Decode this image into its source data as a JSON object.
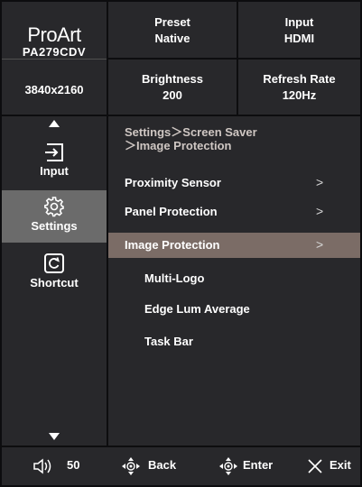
{
  "brand": {
    "name": "ProArt",
    "model": "PA279CDV",
    "resolution": "3840x2160"
  },
  "info": {
    "preset": {
      "label": "Preset",
      "value": "Native"
    },
    "input": {
      "label": "Input",
      "value": "HDMI"
    },
    "brightness": {
      "label": "Brightness",
      "value": "200"
    },
    "refresh_rate": {
      "label": "Refresh Rate",
      "value": "120Hz"
    }
  },
  "nav": {
    "items": [
      {
        "label": "Input",
        "icon": "input-icon",
        "selected": false
      },
      {
        "label": "Settings",
        "icon": "gear-icon",
        "selected": true
      },
      {
        "label": "Shortcut",
        "icon": "shortcut-icon",
        "selected": false
      }
    ]
  },
  "breadcrumb": {
    "line1": "Settings＞Screen Saver",
    "line2": "＞Image Protection"
  },
  "menu": {
    "items": [
      {
        "label": "Proximity Sensor",
        "chevron": ">"
      },
      {
        "label": "Panel Protection",
        "chevron": ">"
      },
      {
        "label": "Image Protection",
        "chevron": ">",
        "selected": true
      }
    ],
    "subitems": [
      {
        "label": "Multi-Logo"
      },
      {
        "label": "Edge Lum Average"
      },
      {
        "label": "Task Bar"
      }
    ]
  },
  "bottom": {
    "volume": "50",
    "back": "Back",
    "enter": "Enter",
    "exit": "Exit"
  },
  "colors": {
    "panel": "#28282b",
    "background": "#0d0d0f",
    "nav_selected": "#6b6b6b",
    "menu_selected": "#7b6c66"
  }
}
